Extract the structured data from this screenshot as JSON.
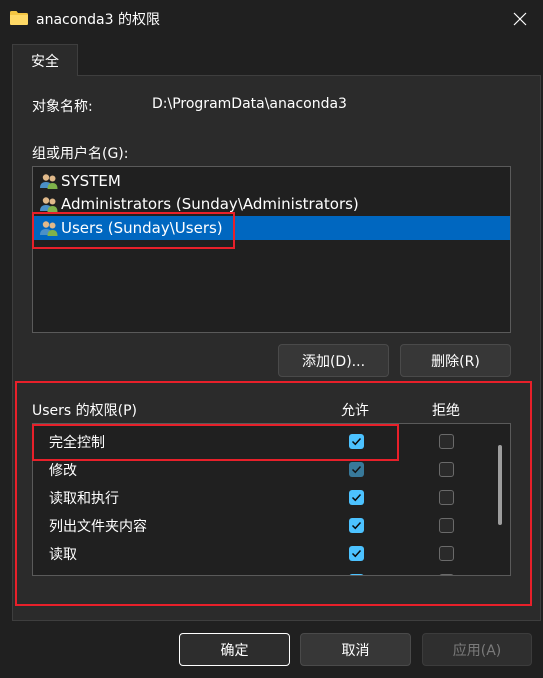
{
  "window": {
    "title": "anaconda3 的权限"
  },
  "tab": {
    "label": "安全"
  },
  "object": {
    "label": "对象名称:",
    "value": "D:\\ProgramData\\anaconda3"
  },
  "groups": {
    "label": "组或用户名(G):",
    "items": [
      {
        "label": "SYSTEM",
        "selected": false
      },
      {
        "label": "Administrators (Sunday\\Administrators)",
        "selected": false
      },
      {
        "label": "Users (Sunday\\Users)",
        "selected": true
      }
    ]
  },
  "buttons": {
    "add": "添加(D)...",
    "remove": "删除(R)"
  },
  "permissions": {
    "header": "Users 的权限(P)",
    "allow_header": "允许",
    "deny_header": "拒绝",
    "rows": [
      {
        "name": "完全控制",
        "allow": true,
        "deny": false
      },
      {
        "name": "修改",
        "allow": false,
        "deny": false
      },
      {
        "name": "读取和执行",
        "allow": true,
        "deny": false
      },
      {
        "name": "列出文件夹内容",
        "allow": true,
        "deny": false
      },
      {
        "name": "读取",
        "allow": true,
        "deny": false
      }
    ]
  },
  "footer": {
    "ok": "确定",
    "cancel": "取消",
    "apply": "应用(A)"
  },
  "colors": {
    "accent": "#0067c0",
    "checkbox": "#4cc2ff",
    "highlight": "#e8202a"
  },
  "icons": {
    "folder": "folder-icon",
    "close": "close-icon",
    "users": "users-icon",
    "check": "check-icon"
  }
}
